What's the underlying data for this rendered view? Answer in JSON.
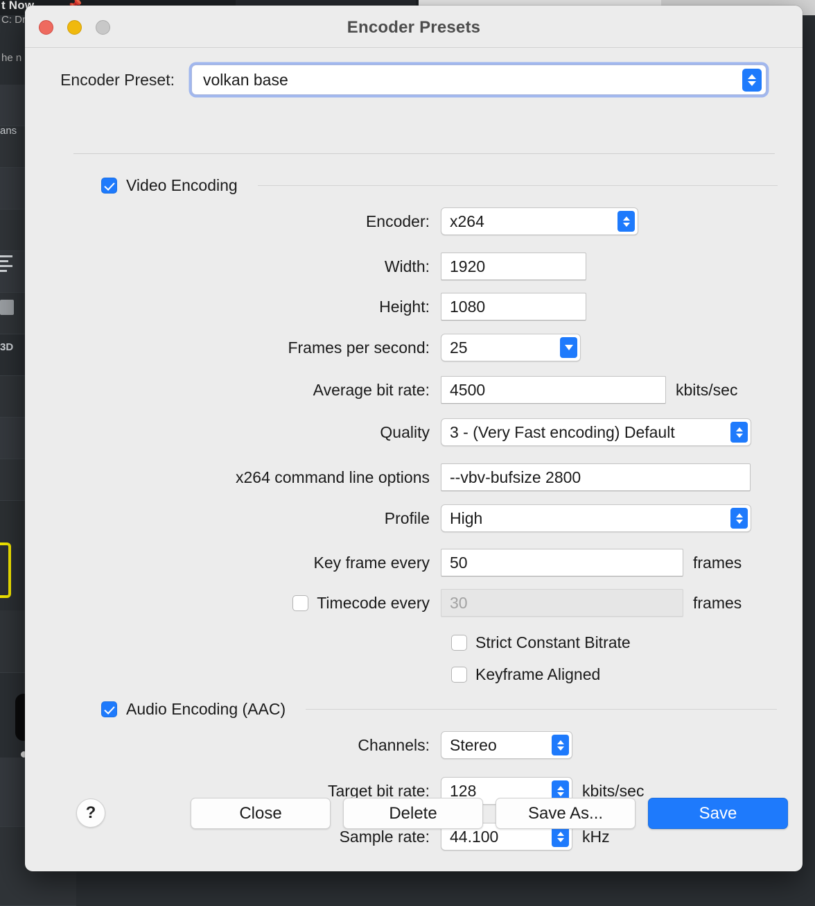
{
  "backdrop": {
    "headline": "t Now",
    "subline": "C: Dr",
    "note": "he n",
    "rows": [
      {
        "text": "ans"
      },
      {
        "text": ""
      },
      {
        "text": ""
      },
      {
        "text": ""
      },
      {
        "text": ""
      },
      {
        "text": "3D"
      },
      {
        "text": ""
      },
      {
        "text": ""
      }
    ]
  },
  "window": {
    "title": "Encoder Presets",
    "traffic": {
      "close": "close-button",
      "minimize": "minimize-button",
      "zoom": "zoom-button"
    }
  },
  "preset": {
    "label": "Encoder Preset:",
    "value": "volkan base"
  },
  "video": {
    "section_label": "Video Encoding",
    "enabled": true,
    "encoder": {
      "label": "Encoder:",
      "value": "x264"
    },
    "width": {
      "label": "Width:",
      "value": "1920"
    },
    "height": {
      "label": "Height:",
      "value": "1080"
    },
    "fps": {
      "label": "Frames per second:",
      "value": "25"
    },
    "avg_bitrate": {
      "label": "Average bit rate:",
      "value": "4500",
      "unit": "kbits/sec"
    },
    "quality": {
      "label": "Quality",
      "value": "3 - (Very Fast encoding) Default"
    },
    "cmdline": {
      "label": "x264 command line options",
      "value": "--vbv-bufsize 2800"
    },
    "profile": {
      "label": "Profile",
      "value": "High"
    },
    "keyframe": {
      "label": "Key frame every",
      "value": "50",
      "unit": "frames"
    },
    "timecode": {
      "label": "Timecode every",
      "value": "30",
      "unit": "frames",
      "checked": false
    },
    "strict_cbr": {
      "label": "Strict Constant Bitrate",
      "checked": false
    },
    "keyframe_aligned": {
      "label": "Keyframe Aligned",
      "checked": false
    }
  },
  "audio": {
    "section_label": "Audio Encoding (AAC)",
    "enabled": true,
    "channels": {
      "label": "Channels:",
      "value": "Stereo"
    },
    "target_bitrate": {
      "label": "Target bit rate:",
      "value": "128",
      "unit": "kbits/sec"
    },
    "sample_rate": {
      "label": "Sample rate:",
      "value": "44.100",
      "unit": "kHz"
    }
  },
  "footer": {
    "help": "?",
    "close": "Close",
    "delete": "Delete",
    "save_as": "Save As...",
    "save": "Save"
  },
  "colors": {
    "accent": "#1e7afc",
    "window_bg": "#ececec",
    "focus_ring": "#648cf0",
    "traffic_red": "#ee6a5f",
    "traffic_yellow": "#f0b90d",
    "traffic_gray": "#c8c8c8",
    "highlight_yellow": "#f2e600"
  }
}
